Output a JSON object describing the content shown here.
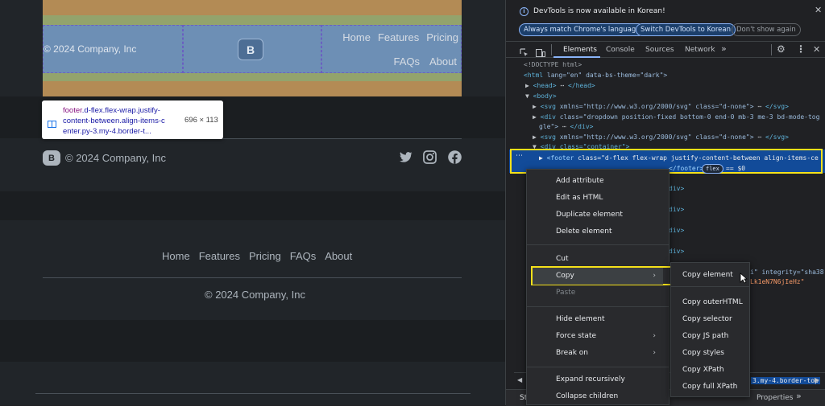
{
  "page": {
    "highlight_footer": {
      "left_text": "© 2024 Company, Inc",
      "logo_letter": "B",
      "nav_row1": [
        "Home",
        "Features",
        "Pricing"
      ],
      "nav_row2": [
        "FAQs",
        "About"
      ]
    },
    "tooltip": {
      "selector_tag": "footer",
      "selector_rest_line1": ".d-flex.flex-wrap.justify-",
      "selector_line2": "content-between.align-items-c",
      "selector_line3": "enter.py-3.my-4.border-t...",
      "size": "696 × 113"
    },
    "footer2": {
      "logo_letter": "B",
      "text": "© 2024 Company, Inc",
      "social_icons": [
        "twitter-icon",
        "instagram-icon",
        "facebook-icon"
      ]
    },
    "footer3": {
      "links": [
        "Home",
        "Features",
        "Pricing",
        "FAQs",
        "About"
      ],
      "copyright": "© 2024 Company, Inc"
    }
  },
  "devtools": {
    "banner": {
      "text": "DevTools is now available in Korean!",
      "btn_match": "Always match Chrome's language",
      "btn_switch": "Switch DevTools to Korean",
      "btn_dont": "Don't show again"
    },
    "tabs": [
      "Elements",
      "Console",
      "Sources",
      "Network"
    ],
    "active_tab": "Elements",
    "dom": {
      "l1": "<!DOCTYPE html>",
      "l2_tag": "<html",
      "l2_attrs": " lang=\"en\" data-bs-theme=\"dark\">",
      "l3": "<head>",
      "l3_end": "</head>",
      "l4": "<body>",
      "l5_a": "<svg",
      "l5_b": " xmlns=\"http://www.w3.org/2000/svg\" class=\"d-none\">",
      "l5_c": "</svg>",
      "l6_a": "<div",
      "l6_b": " class=\"dropdown position-fixed bottom-0 end-0 mb-3 me-3 bd-mode-tog",
      "l6_c": "gle\">",
      "l6_d": "</div>",
      "l7_a": "<svg",
      "l7_b": " xmlns=\"http://www.w3.org/2000/svg\" class=\"d-none\">",
      "l7_c": "</svg>",
      "l8": "<div class=\"container\">",
      "sel_a": "<footer",
      "sel_b": " class=\"d-flex flex-wrap justify-content-between align-items-ce",
      "sel_c": "</footer>",
      "sel_badge": "flex",
      "sel_eq": "== $0",
      "frag1": "div>",
      "frag2": "div>",
      "frag3": "div>",
      "frag4": "div>",
      "frag5": "i\" integrity=\"sha38",
      "frag6": "Lk1eN7N6jIeHz\"",
      "breadcrumb_tail": "3.my-4.border-top",
      "bottom_tab1": "St",
      "bottom_tab_right": "Properties"
    },
    "context_menu": {
      "items": [
        "Add attribute",
        "Edit as HTML",
        "Duplicate element",
        "Delete element",
        "Cut",
        "Copy",
        "Paste",
        "Hide element",
        "Force state",
        "Break on",
        "Expand recursively",
        "Collapse children"
      ]
    },
    "submenu": {
      "items": [
        "Copy element",
        "Copy outerHTML",
        "Copy selector",
        "Copy JS path",
        "Copy styles",
        "Copy XPath",
        "Copy full XPath"
      ]
    },
    "colors": {
      "highlight_yellow": "#f5e11a",
      "selected_row": "#124b99",
      "accent": "#8ab4f8"
    }
  }
}
